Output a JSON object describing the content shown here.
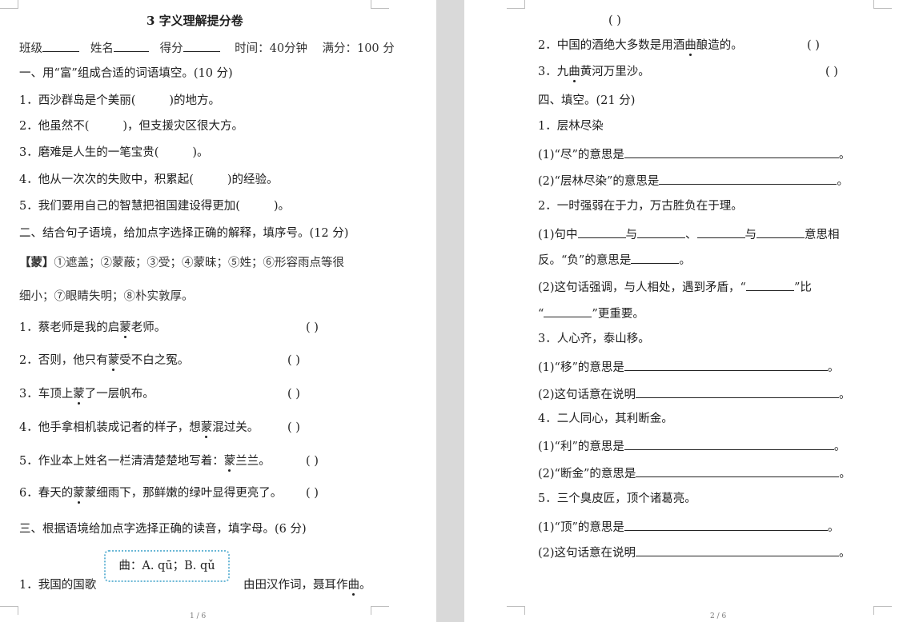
{
  "page1": {
    "title": "3  字义理解提分卷",
    "header": {
      "class_label": "班级",
      "name_label": "姓名",
      "score_label": "得分",
      "time": "时间：40分钟",
      "full": "满分：100 分"
    },
    "sec1": {
      "heading": "一、用“富”组成合适的词语填空。(10 分)",
      "items": [
        {
          "pre": "1．西沙群岛是个美丽(",
          "post": ")的地方。"
        },
        {
          "pre": "2．他虽然不(",
          "post": ")，但支援灾区很大方。"
        },
        {
          "pre": "3．磨难是人生的一笔宝贵(",
          "post": ")。"
        },
        {
          "pre": "4．他从一次次的失败中，积累起(",
          "post": ")的经验。"
        },
        {
          "pre": "5．我们要用自己的智慧把祖国建设得更加(",
          "post": ")。"
        }
      ]
    },
    "sec2": {
      "heading": "二、结合句子语境，给加点字选择正确的解释，填序号。(12 分)",
      "def_label": "【蒙】",
      "def_line1": "①遮盖；②蒙蔽；③受；④蒙昧；⑤姓；⑥形容雨点等很",
      "def_line2": "细小；⑦眼睛失明；⑧朴实敦厚。",
      "items": [
        {
          "pre": "1．",
          "mid": "蔡老师是我的启",
          "dot": "蒙",
          "post": "老师。",
          "paren": "(      )"
        },
        {
          "pre": "2．",
          "mid": "否则，他只有",
          "dot": "蒙",
          "post": "受不白之冤。",
          "paren": "(      )"
        },
        {
          "pre": "3．",
          "mid": "车顶上",
          "dot": "蒙",
          "post": "了一层帆布。",
          "paren": "(      )"
        },
        {
          "pre": "4．",
          "mid": "他手拿相机装成记者的样子，想",
          "dot": "蒙",
          "post": "混过关。",
          "paren": "(      )"
        },
        {
          "pre": "5．",
          "mid": "作业本上姓名一栏清清楚楚地写着：",
          "dot": "蒙",
          "post": "兰兰。",
          "paren": "(      )"
        },
        {
          "pre": "6．",
          "mid": "春天的",
          "dot": "蒙",
          "post": "蒙细雨下，那鲜嫩的绿叶显得更亮了。",
          "paren": "(      )"
        }
      ]
    },
    "sec3": {
      "heading": "三、根据语境给加点字选择正确的读音，填字母。(6 分)",
      "box": "曲：A. qū；B. qǔ",
      "item1_pre": "1．我国的国歌",
      "item1_post_a": "由田汉作词，聂耳作",
      "item1_dot": "曲",
      "item1_post_b": "。"
    },
    "footer": "1 / 6"
  },
  "page2": {
    "top_paren": "(      )",
    "sec3_cont": [
      {
        "text_a": "2．中国的酒绝大多数是用酒",
        "dot": "曲",
        "text_b": "酿造的。",
        "paren": "(      )"
      },
      {
        "text_a": "3．九",
        "dot": "曲",
        "text_b": "黄河万里沙。",
        "paren": "(      )"
      }
    ],
    "sec4": {
      "heading": "四、填空。(21 分)",
      "q1": "1．层林尽染",
      "q1a": "(1)“尽”的意思是",
      "q1b": "(2)“层林尽染”的意思是",
      "q2": "2．一时强弱在于力，万古胜负在于理。",
      "q2a_1": "(1)句中",
      "q2a_2": "与",
      "q2a_3": "、",
      "q2a_4": "与",
      "q2a_5": "意思相",
      "q2a_6": "反。“负”的意思是",
      "q2b_1": "(2)这句话强调，与人相处，遇到矛盾，“",
      "q2b_2": "”比",
      "q2b_3": "“",
      "q2b_4": "”更重要。",
      "q3": "3．人心齐，泰山移。",
      "q3a": "(1)“移”的意思是",
      "q3b": "(2)这句话意在说明",
      "q4": "4．二人同心，其利断金。",
      "q4a": "(1)“利”的意思是",
      "q4b": "(2)“断金”的意思是",
      "q5": "5．三个臭皮匠，顶个诸葛亮。",
      "q5a": "(1)“顶”的意思是",
      "q5b": "(2)这句话意在说明",
      "period": "。"
    },
    "footer": "2 / 6"
  }
}
